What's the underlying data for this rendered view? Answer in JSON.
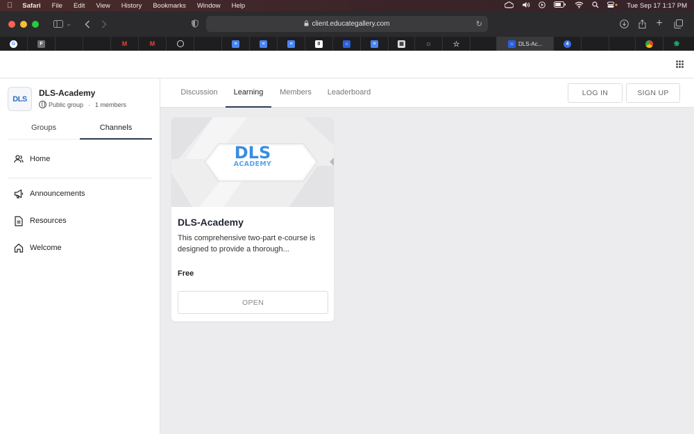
{
  "menubar": {
    "app": "Safari",
    "items": [
      "File",
      "Edit",
      "View",
      "History",
      "Bookmarks",
      "Window",
      "Help"
    ],
    "datetime": "Tue Sep 17  1:17 PM"
  },
  "browser": {
    "url": "client.educategallery.com",
    "active_tab_label": "DLS-Ac...",
    "badge_count": "4"
  },
  "group": {
    "name": "DLS-Academy",
    "logo_text": "DLS",
    "visibility": "Public group",
    "separator": "·",
    "members": "1 members"
  },
  "side_tabs": [
    {
      "label": "Groups"
    },
    {
      "label": "Channels"
    }
  ],
  "nav": {
    "home": "Home",
    "announcements": "Announcements",
    "resources": "Resources",
    "welcome": "Welcome"
  },
  "main_tabs": [
    {
      "label": "Discussion"
    },
    {
      "label": "Learning"
    },
    {
      "label": "Members"
    },
    {
      "label": "Leaderboard"
    }
  ],
  "auth": {
    "login": "LOG IN",
    "signup": "SIGN UP"
  },
  "course": {
    "logo_top": "DLS",
    "logo_bottom": "ACADEMY",
    "title": "DLS-Academy",
    "description": "This comprehensive two-part e-course is designed to provide a thorough...",
    "price": "Free",
    "cta": "OPEN"
  },
  "colors": {
    "accent_underline": "#2b3a52",
    "logo_blue": "#2f6fc0"
  }
}
